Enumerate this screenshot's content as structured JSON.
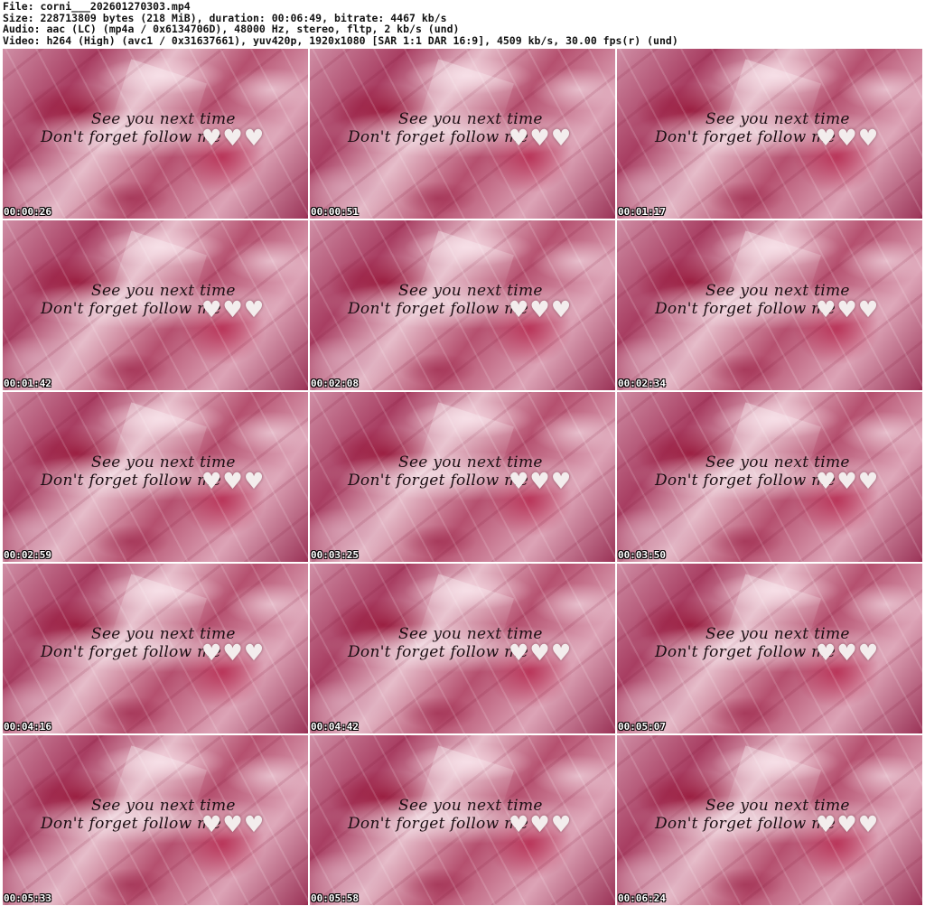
{
  "header": {
    "file_line": "File: corni___202601270303.mp4",
    "size_line": "Size: 228713809 bytes (218 MiB), duration: 00:06:49, bitrate: 4467 kb/s",
    "audio_line": "Audio: aac (LC) (mp4a / 0x6134706D), 48000 Hz, stereo, fltp, 2 kb/s (und)",
    "video_line": "Video: h264 (High) (avc1 / 0x31637661), yuv420p, 1920x1080 [SAR 1:1 DAR 16:9], 4509 kb/s, 30.00 fps(r) (und)"
  },
  "overlay_text": {
    "line1": "See you next time",
    "line2": "Don't forget follow me",
    "hearts": "♥♥♥",
    "heart_color": "#f3eded"
  },
  "thumbnails": [
    {
      "timestamp": "00:00:26"
    },
    {
      "timestamp": "00:00:51"
    },
    {
      "timestamp": "00:01:17"
    },
    {
      "timestamp": "00:01:42"
    },
    {
      "timestamp": "00:02:08"
    },
    {
      "timestamp": "00:02:34"
    },
    {
      "timestamp": "00:02:59"
    },
    {
      "timestamp": "00:03:25"
    },
    {
      "timestamp": "00:03:50"
    },
    {
      "timestamp": "00:04:16"
    },
    {
      "timestamp": "00:04:42"
    },
    {
      "timestamp": "00:05:07"
    },
    {
      "timestamp": "00:05:33"
    },
    {
      "timestamp": "00:05:58"
    },
    {
      "timestamp": "00:06:24"
    }
  ],
  "colors": {
    "background": "#ffffff",
    "header_text": "#111111",
    "timestamp_text": "#ffffff",
    "overlay_text": "#1a0d12"
  }
}
